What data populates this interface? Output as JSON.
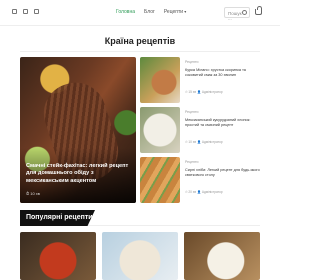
{
  "header": {
    "social_icons": [
      "instagram-icon",
      "twitter-icon",
      "pinterest-icon"
    ],
    "nav": [
      {
        "label": "Головна",
        "active": true
      },
      {
        "label": "Блог",
        "active": false
      },
      {
        "label": "Рецепти",
        "active": false,
        "dropdown": true
      }
    ],
    "search_placeholder": "Пошук ...",
    "accent_color": "#2e9b57"
  },
  "page_title": "Країна рецептів",
  "hero": {
    "title": "Смачні стейк-фахітас: легкий рецепт для домашнього обіду з мексиканським акцентом",
    "meta": "10 хв"
  },
  "side_articles": [
    {
      "category": "Рецепти",
      "title": "Курка Мілано: хрустка скоринка та соковитий смак за 30 хвилин",
      "time": "15 хв",
      "author": "Адміністратор"
    },
    {
      "category": "Рецепти",
      "title": "Мексиканський кукурудзяний хлопок: простий та смачний рецепт",
      "time": "10 хв",
      "author": "Адміністратор"
    },
    {
      "category": "Рецепти",
      "title": "Сирні хліби: Легкий рецепт для будь-якого святкового столу",
      "time": "20 хв",
      "author": "Адміністратор"
    }
  ],
  "popular": {
    "label": "Популярні рецепти"
  }
}
